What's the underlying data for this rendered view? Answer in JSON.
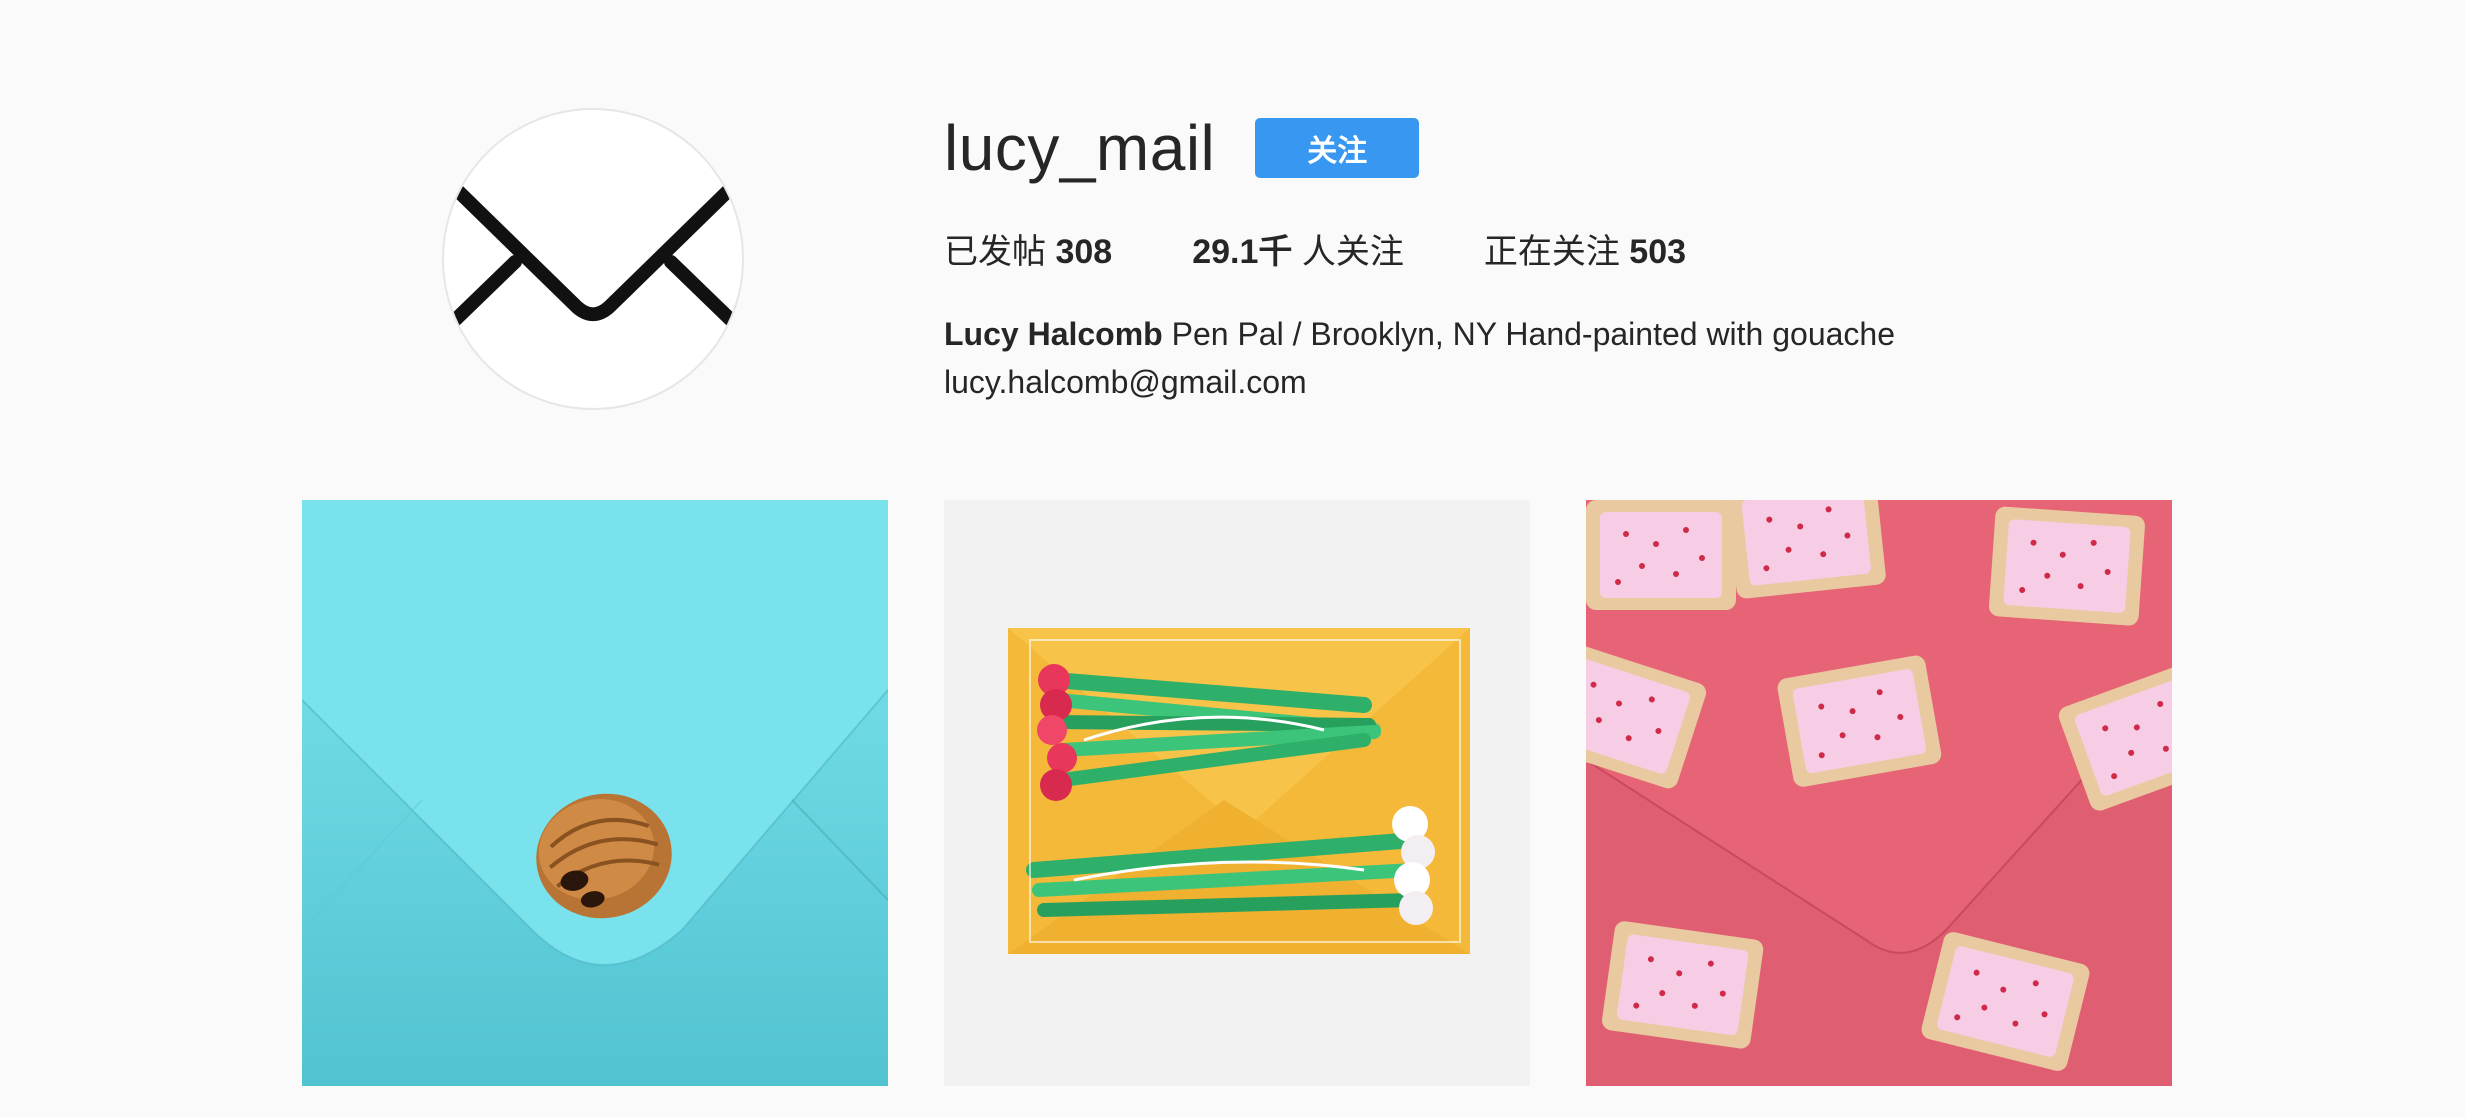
{
  "profile": {
    "username": "lucy_mail",
    "follow_label": "关注",
    "avatar_icon": "envelope-icon"
  },
  "stats": {
    "posts_label": "已发帖",
    "posts_value": "308",
    "followers_value": "29.1千",
    "followers_label": "人关注",
    "following_label": "正在关注",
    "following_value": "503"
  },
  "bio": {
    "full_name": "Lucy Halcomb",
    "text": "Pen Pal / Brooklyn, NY Hand-painted with gouache",
    "email": "lucy.halcomb@gmail.com"
  },
  "colors": {
    "accent": "#3897f0",
    "post1_bg": "#6fd6e0",
    "post2_bg": "#f4f4f4",
    "post3_bg": "#e8677a"
  }
}
